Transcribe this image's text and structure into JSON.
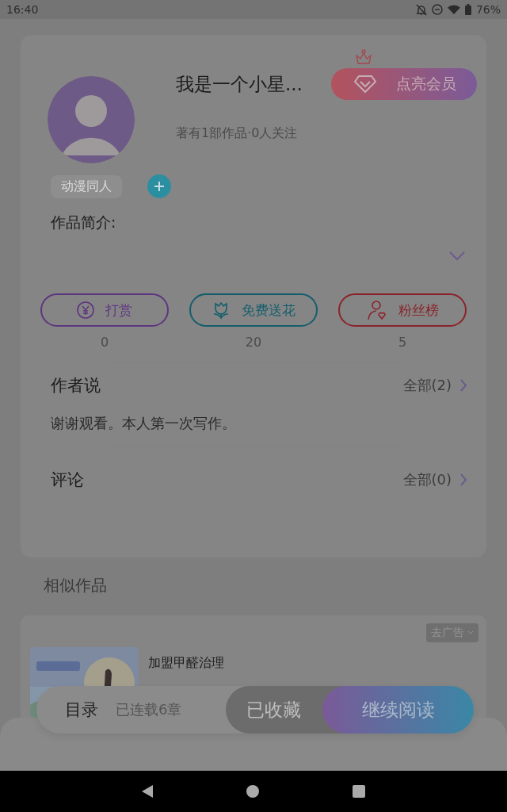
{
  "status_bar": {
    "time": "16:40",
    "battery": "76%"
  },
  "author": {
    "name": "我是一个小星...",
    "stats": "著有1部作品·0人关注",
    "vip_button": "点亮会员"
  },
  "tags": [
    "动漫同人"
  ],
  "intro": {
    "label": "作品简介:",
    "expanded": false
  },
  "actions": [
    {
      "kind": "reward",
      "label": "打赏",
      "count": "0",
      "color": "#5e3580"
    },
    {
      "kind": "flower",
      "label": "免费送花",
      "count": "20",
      "color": "#145e6c"
    },
    {
      "kind": "fans",
      "label": "粉丝榜",
      "count": "5",
      "color": "#8a2329"
    }
  ],
  "author_notes": {
    "title": "作者说",
    "more": "全部(2)",
    "text": "谢谢观看。本人第一次写作。"
  },
  "comments": {
    "title": "评论",
    "more": "全部(0)"
  },
  "similar": {
    "title": "相似作品",
    "ad": {
      "close_label": "去广告",
      "title": "加盟甲醛治理",
      "kind": "picture"
    }
  },
  "bottom_bar": {
    "toc": "目录",
    "progress": "已连载6章",
    "collect": "已收藏",
    "read": "继续阅读"
  }
}
